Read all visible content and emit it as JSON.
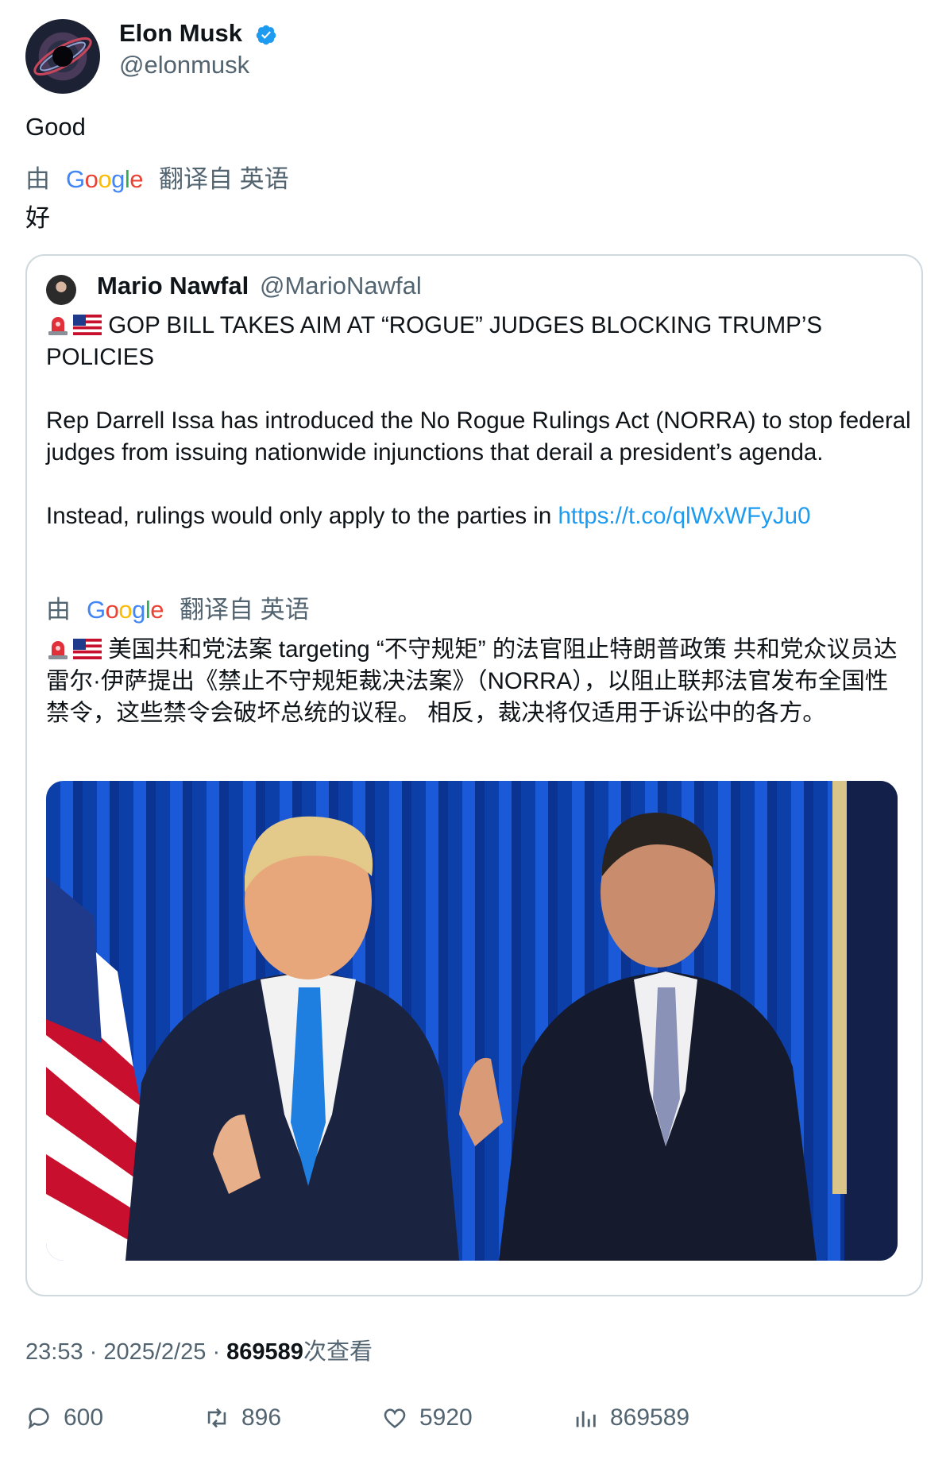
{
  "author": {
    "name": "Elon Musk",
    "handle": "@elonmusk",
    "verified": true
  },
  "tweet": {
    "text": "Good",
    "translation_by": "由",
    "translation_provider": "Google",
    "translation_source": "翻译自 英语",
    "translated_text": "好"
  },
  "quote": {
    "name": "Mario Nawfal",
    "handle": "@MarioNawfal",
    "headline": "GOP BILL TAKES AIM AT “ROGUE” JUDGES BLOCKING TRUMP’S POLICIES",
    "paragraph1": "Rep Darrell Issa has introduced the No Rogue Rulings Act (NORRA) to stop federal judges from issuing nationwide injunctions that derail a president’s agenda.",
    "paragraph2_prefix": "Instead, rulings would only apply to the parties in ",
    "link": "https://t.co/qlWxWFyJu0",
    "translation_by": "由",
    "translation_provider": "Google",
    "translation_source": "翻译自 英语",
    "translated_text": "美国共和党法案 targeting “不守规矩” 的法官阻止特朗普政策 共和党众议员达雷尔·伊萨提出《禁止不守规矩裁决法案》（NORRA），以阻止联邦法官发布全国性禁令，这些禁令会破坏总统的议程。 相反，裁决将仅适用于诉讼中的各方。"
  },
  "meta": {
    "time": "23:53",
    "date": "2025/2/25",
    "views": "869589",
    "views_label": "次查看"
  },
  "actions": {
    "replies": "600",
    "retweets": "896",
    "likes": "5920",
    "views": "869589"
  },
  "colors": {
    "accent": "#1d9bf0",
    "muted": "#536471",
    "text": "#0f1419",
    "border": "#cfd9de"
  }
}
